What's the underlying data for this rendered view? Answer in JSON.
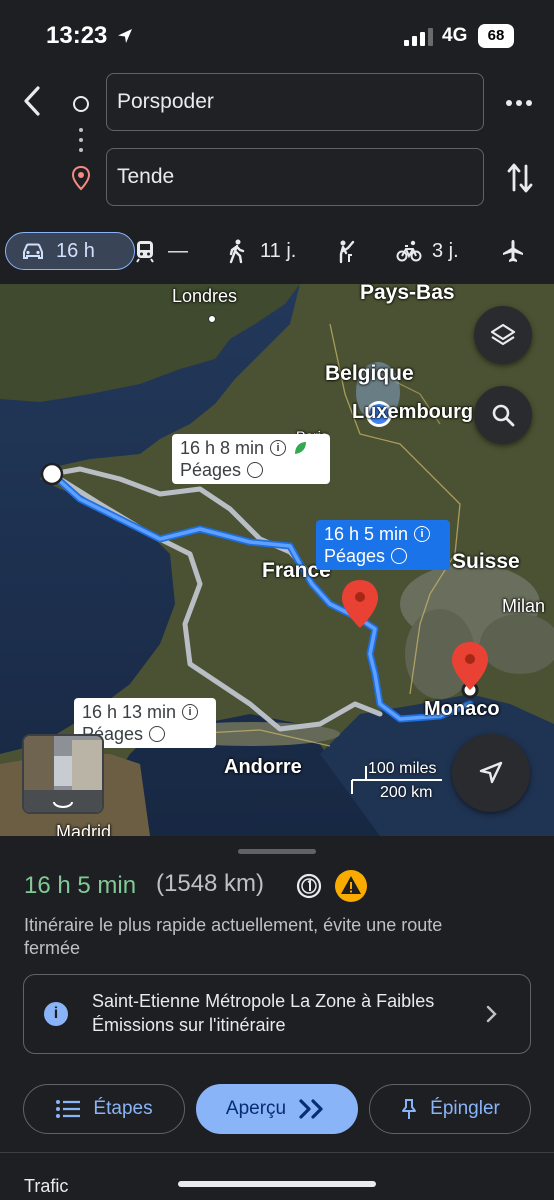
{
  "status_bar": {
    "time": "13:23",
    "network": "4G",
    "battery": "68"
  },
  "search": {
    "origin": "Porspoder",
    "destination": "Tende"
  },
  "modes": [
    {
      "icon": "car-icon",
      "label": "16 h"
    },
    {
      "icon": "transit-icon",
      "label": "—"
    },
    {
      "icon": "walk-icon",
      "label": "11 j."
    },
    {
      "icon": "ride-icon",
      "label": ""
    },
    {
      "icon": "bike-icon",
      "label": "3 j."
    },
    {
      "icon": "flight-icon",
      "label": ""
    }
  ],
  "map": {
    "places": [
      "Londres",
      "Pays-Bas",
      "Belgique",
      "Luxembourg",
      "France",
      "Suisse",
      "Milan",
      "Monaco",
      "Andorre",
      "Madrid",
      "Paris"
    ],
    "routes": [
      {
        "time": "16 h 8 min",
        "tolls": "Péages",
        "eco": true
      },
      {
        "time": "16 h 5 min",
        "tolls": "Péages",
        "selected": true
      },
      {
        "time": "16 h 13 min",
        "tolls": "Péages"
      }
    ],
    "scale": {
      "miles": "100 miles",
      "km": "200 km"
    }
  },
  "summary": {
    "duration": "16 h 5 min",
    "distance": "(1548 km)",
    "description": "Itinéraire le plus rapide actuellement, évite une route fermée",
    "notice": "Saint-Etienne Métropole La Zone à Faibles Émissions sur l'itinéraire"
  },
  "actions": {
    "steps": "Étapes",
    "preview": "Aperçu",
    "pin": "Épingler"
  },
  "next_section": "Trafic",
  "colors": {
    "route_selected": "#3b82f6",
    "route_alt": "#b9bec4",
    "accent": "#8ab4f8",
    "duration_green": "#81c995",
    "pin_red": "#e94235"
  }
}
